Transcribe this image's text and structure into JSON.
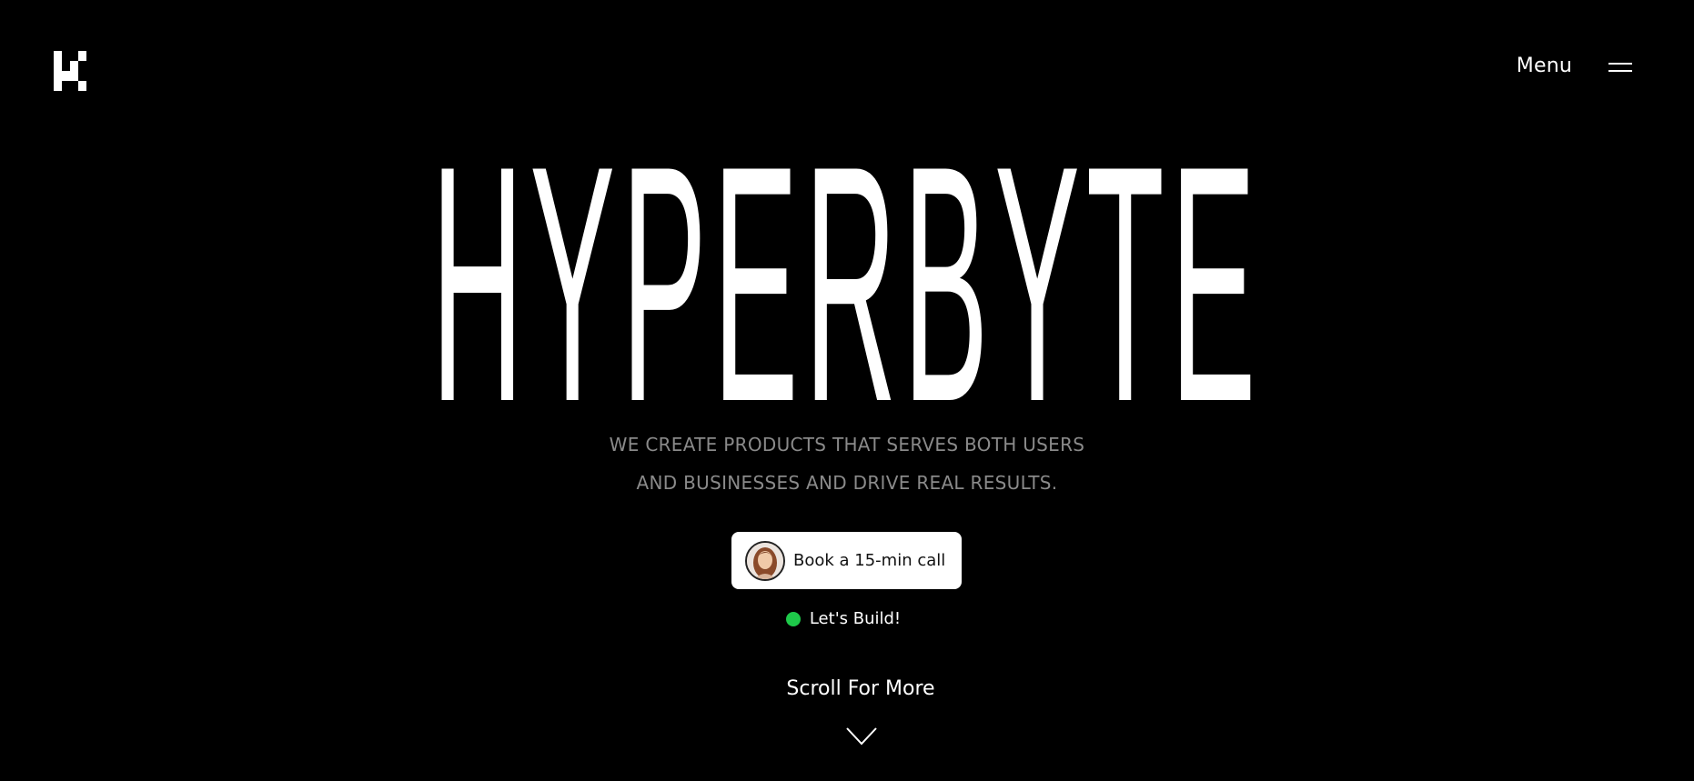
{
  "header": {
    "logo_icon": "k-pixel-logo-icon",
    "menu_label": "Menu",
    "menu_icon": "hamburger-icon"
  },
  "hero": {
    "title": "HYPERBYTE",
    "subtitle_line1": "WE CREATE PRODUCTS THAT SERVES BOTH USERS",
    "subtitle_line2": "AND BUSINESSES AND DRIVE REAL RESULTS."
  },
  "cta": {
    "label": "Book a 15-min call",
    "avatar_icon": "avatar"
  },
  "status": {
    "label": "Let's Build!",
    "dot_color": "#1ec94a"
  },
  "scroll": {
    "label": "Scroll For More",
    "icon": "chevron-down-icon"
  },
  "colors": {
    "background": "#000000",
    "text": "#ffffff",
    "subtitle": "#8a8a8a",
    "button_bg": "#ffffff",
    "button_text": "#111111"
  }
}
